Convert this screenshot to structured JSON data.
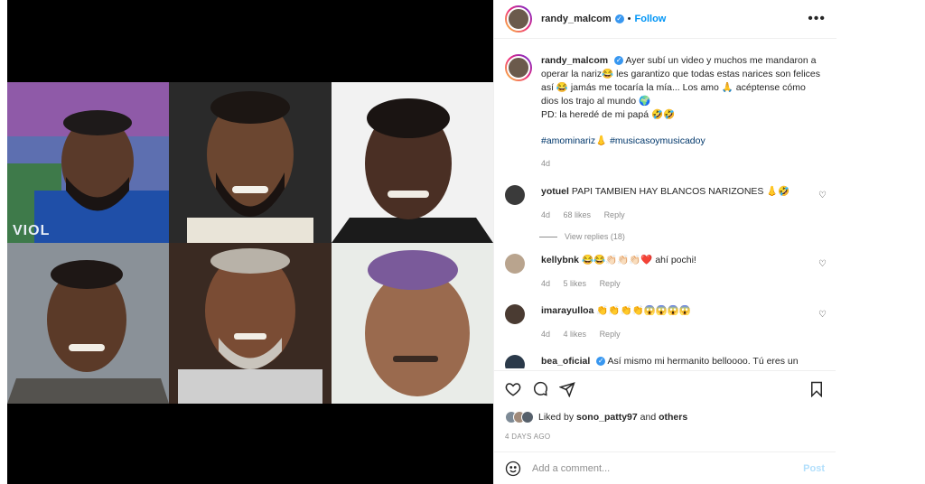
{
  "post": {
    "username": "randy_malcom",
    "verified_mark": "✓",
    "separator": "•",
    "follow_label": "Follow",
    "more_label": "•••",
    "caption": {
      "username": "randy_malcom",
      "text": "Ayer subí un video y muchos me mandaron a operar la nariz😂 les garantizo que todas estas narices son felices así 😂 jamás me tocaría la mía... Los amo 🙏 acéptense cómo dios los trajo al mundo 🌍",
      "ps": "PD: la heredé de mi papá 🤣🤣",
      "hashtags": "#amominariz👃 #musicasoymusicadoy",
      "age": "4d"
    },
    "comments": [
      {
        "username": "yotuel",
        "text": "PAPI TAMBIEN HAY BLANCOS NARIZONES 👃🤣",
        "age": "4d",
        "likes": "68 likes",
        "reply": "Reply",
        "view_replies": "View replies (18)",
        "avatar_color": "#3a3a3a"
      },
      {
        "username": "kellybnk",
        "text": "😂😂👏🏻👏🏻👏🏻❤️ ahí pochi!",
        "age": "4d",
        "likes": "5 likes",
        "reply": "Reply",
        "avatar_color": "#b9a48e"
      },
      {
        "username": "imarayulloa",
        "text": "👏👏👏👏😱😱😱😱",
        "age": "4d",
        "likes": "4 likes",
        "reply": "Reply",
        "avatar_color": "#4a3b32"
      },
      {
        "username": "bea_oficial",
        "text": "Así mismo mi hermanito belloooo. Tú eres un",
        "avatar_color": "#2b3a4a"
      }
    ],
    "liked_by_prefix": "Liked by",
    "liked_by_user": "sono_patty97",
    "liked_by_and": "and",
    "liked_by_others": "others",
    "timestamp": "4 DAYS AGO",
    "comment_placeholder": "Add a comment...",
    "post_label": "Post",
    "tile_caption": "VIOL"
  },
  "colors": {
    "link": "#0095f6",
    "hashtag": "#00376b",
    "muted": "#8e8e8e",
    "post_disabled": "#b2dffc"
  }
}
